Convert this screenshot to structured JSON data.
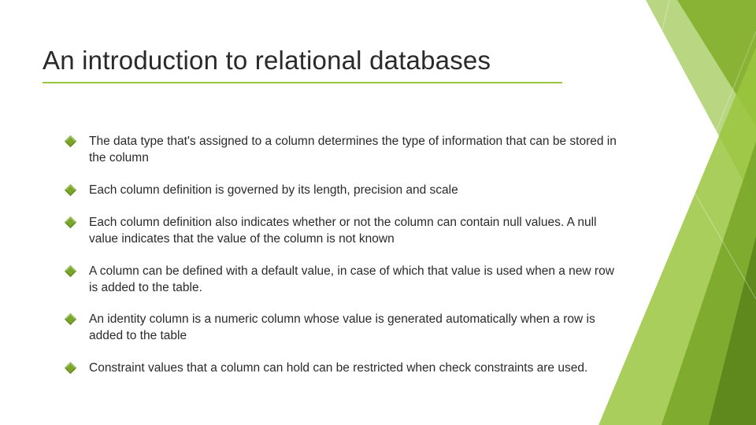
{
  "title": "An introduction to relational databases",
  "bullets": [
    "The data type that's assigned to a column determines the type of information that can be stored in the column",
    "Each column definition is governed by its length, precision and scale",
    "Each column definition also indicates whether or not the column can contain null values. A null value indicates that the value of the column is not known",
    "A column can be defined with a default value, in case of which that value is used when a new row is added to the table.",
    "An identity column is a numeric column whose value is generated automatically when a row is added to the table",
    "Constraint values that a column can hold can be restricted when check constraints are used."
  ]
}
